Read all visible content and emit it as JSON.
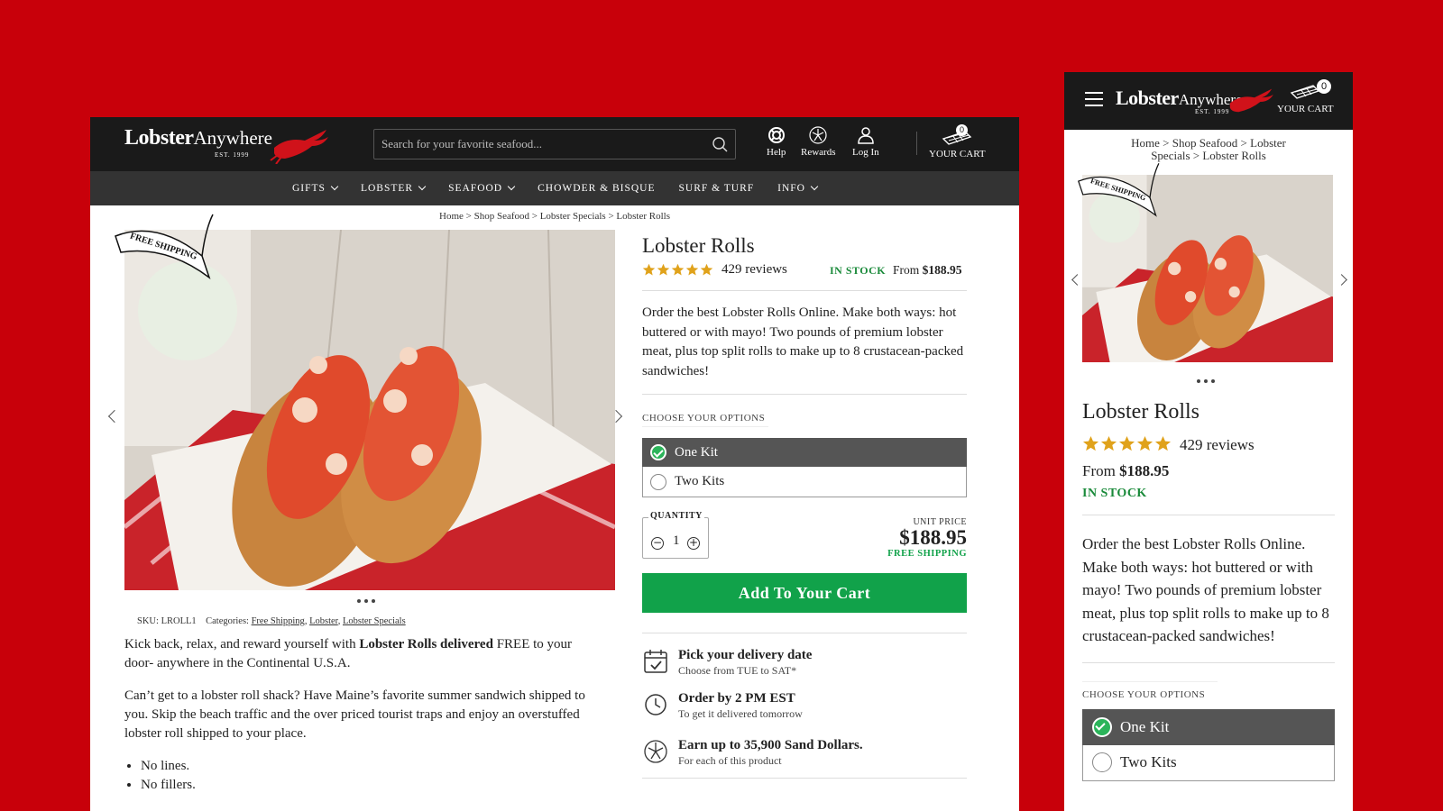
{
  "brand": {
    "name_part1": "Lobster",
    "name_part2": "Anywhere",
    "est": "EST. 1999"
  },
  "colors": {
    "background": "#c8000a",
    "header": "#1a1a1a",
    "nav": "#333333",
    "accent_green": "#11a24a",
    "star": "#e0a21b"
  },
  "search": {
    "placeholder": "Search for your favorite seafood..."
  },
  "header_icons": {
    "help": "Help",
    "rewards": "Rewards",
    "login": "Log In",
    "cart": "YOUR CART",
    "cart_count": "0"
  },
  "nav": [
    {
      "label": "GIFTS",
      "has_dropdown": true
    },
    {
      "label": "LOBSTER",
      "has_dropdown": true
    },
    {
      "label": "SEAFOOD",
      "has_dropdown": true
    },
    {
      "label": "CHOWDER & BISQUE",
      "has_dropdown": false
    },
    {
      "label": "SURF & TURF",
      "has_dropdown": false
    },
    {
      "label": "INFO",
      "has_dropdown": true
    }
  ],
  "breadcrumb": {
    "desktop": "Home > Shop Seafood > Lobster Specials > Lobster Rolls",
    "mobile_line1": "Home > Shop Seafood > Lobster",
    "mobile_line2": "Specials > Lobster Rolls"
  },
  "ribbon": "FREE SHIPPING",
  "product": {
    "title": "Lobster Rolls",
    "rating_stars": 5,
    "reviews": "429 reviews",
    "stock": "IN STOCK",
    "price_from_label": "From",
    "price_from": "$188.95",
    "description": "Order the best Lobster Rolls Online. Make both ways: hot buttered or with mayo! Two pounds of premium lobster meat, plus  top split rolls to make up to 8 crustacean-packed sandwiches!",
    "options_label": "CHOOSE YOUR OPTIONS",
    "options": [
      {
        "label": "One Kit",
        "selected": true
      },
      {
        "label": "Two Kits",
        "selected": false
      }
    ],
    "quantity_label": "QUANTITY",
    "quantity": "1",
    "unit_price_label": "UNIT PRICE",
    "unit_price": "$188.95",
    "free_shipping": "FREE SHIPPING",
    "add_to_cart": "Add To Your Cart",
    "perks": [
      {
        "icon": "calendar-icon",
        "title": "Pick your delivery date",
        "sub": "Choose from TUE to SAT*"
      },
      {
        "icon": "clock-icon",
        "title": "Order by 2 PM EST",
        "sub": "To get it delivered tomorrow"
      },
      {
        "icon": "sand-dollar-icon",
        "title": "Earn up to 35,900 Sand Dollars.",
        "sub": "For each of this product"
      }
    ]
  },
  "meta": {
    "sku_label": "SKU:",
    "sku": "LROLL1",
    "categories_label": "Categories:",
    "categories": [
      "Free Shipping",
      "Lobster",
      "Lobster Specials"
    ]
  },
  "body": {
    "p1_pre": "Kick back, relax, and reward yourself with ",
    "p1_bold": "Lobster Rolls delivered",
    "p1_post": " FREE to your door- anywhere in the Continental U.S.A.",
    "p2": "Can’t get to a lobster roll shack? Have Maine’s favorite summer sandwich shipped to you. Skip the beach traffic and the over priced tourist traps and enjoy an overstuffed lobster roll shipped to your place.",
    "bullets": [
      "No lines.",
      "No fillers."
    ]
  }
}
